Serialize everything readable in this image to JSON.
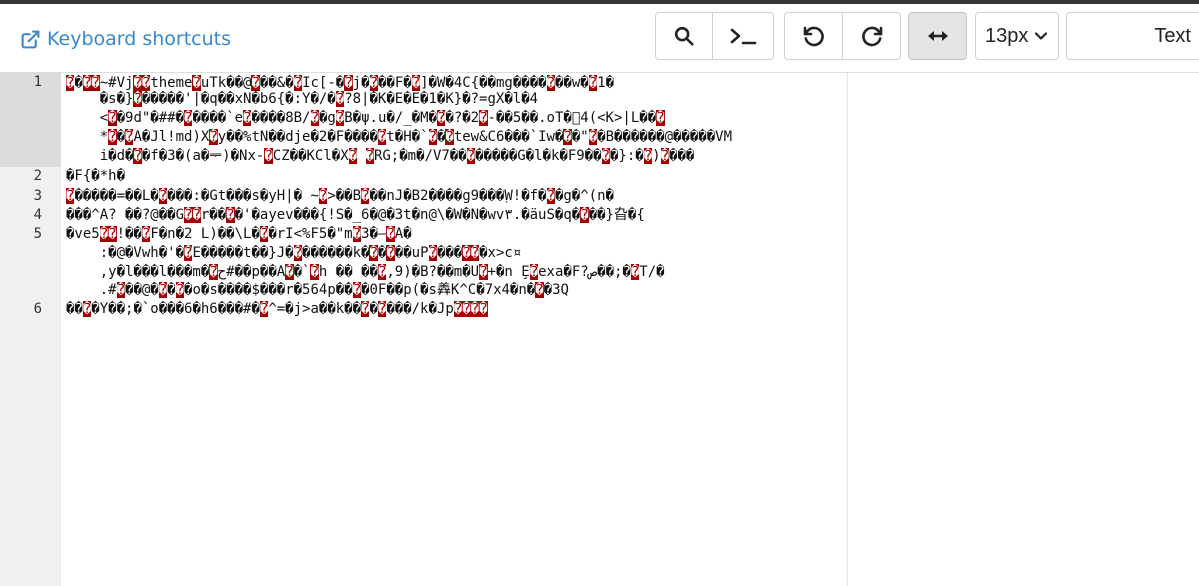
{
  "toolbar": {
    "keyboard_shortcuts_label": "Keyboard shortcuts",
    "font_size_value": "13px",
    "mode_value": "Text"
  },
  "icons": {
    "external_link": "external-link-icon",
    "search": "search-icon",
    "terminal": "terminal-icon",
    "undo": "undo-icon",
    "redo": "redo-icon",
    "wrap": "wrap-arrows-icon",
    "chevron": "chevron-down-icon"
  },
  "colors": {
    "link": "#3a87c8",
    "invalid_char_bg": "#a00000",
    "gutter_bg": "#f0f0f0",
    "gutter_active_bg": "#dcdcdc"
  },
  "editor": {
    "line_numbers": [
      "1",
      "2",
      "3",
      "4",
      "5",
      "6"
    ],
    "lines": [
      [
        [
          {
            "b": "�"
          },
          {
            "t": "�"
          },
          {
            "b": "��"
          },
          {
            "t": "~#Vj"
          },
          {
            "b": "��"
          },
          {
            "t": "theme"
          },
          {
            "b": "�"
          },
          {
            "t": "uTk��@"
          },
          {
            "b": "�"
          },
          {
            "t": "��&�"
          },
          {
            "b": "�"
          },
          {
            "t": "Ic[-�"
          },
          {
            "b": "�"
          },
          {
            "t": "j�"
          },
          {
            "b": "�"
          },
          {
            "t": "��F�"
          },
          {
            "b": "�"
          },
          {
            "t": "]�W�4C{��mg����"
          },
          {
            "b": "�"
          },
          {
            "t": "��w�"
          },
          {
            "b": "�"
          },
          {
            "t": "1�"
          }
        ],
        [
          {
            "t": "    �s�}"
          },
          {
            "b": "�"
          },
          {
            "t": "�����'|�q��xN�b6{�:Y�/�"
          },
          {
            "b": "�"
          },
          {
            "t": "?8|�K�E�E�1�K}�?=gX�l�4"
          }
        ],
        [
          {
            "t": "    <"
          },
          {
            "b": "�"
          },
          {
            "t": "�9d\"�##�"
          },
          {
            "b": "�"
          },
          {
            "t": "����`e"
          },
          {
            "b": "�"
          },
          {
            "t": "����8B/"
          },
          {
            "b": "�"
          },
          {
            "t": "�g"
          },
          {
            "b": "�"
          },
          {
            "t": "B�ψ.u�/_�M�"
          },
          {
            "b": "�"
          },
          {
            "t": "�?�2"
          },
          {
            "b": "�"
          },
          {
            "t": "-��5��.oT�⃞4(<K>|L��"
          },
          {
            "b": "�"
          }
        ],
        [
          {
            "t": "    *"
          },
          {
            "b": "�"
          },
          {
            "t": "�"
          },
          {
            "b": "�"
          },
          {
            "t": "A�Jl!md)X"
          },
          {
            "b": "�"
          },
          {
            "t": "y��%tN��dje�2�F����"
          },
          {
            "b": "�"
          },
          {
            "t": "t�H�`"
          },
          {
            "b": "�"
          },
          {
            "t": "�"
          },
          {
            "b": "�"
          },
          {
            "t": "tew&C6���`Iw�"
          },
          {
            "b": "�"
          },
          {
            "t": "�\""
          },
          {
            "b": "�"
          },
          {
            "t": "�B������@�����VM"
          }
        ],
        [
          {
            "t": "    i�d�"
          },
          {
            "b": "�"
          },
          {
            "t": "�f�3�(a�ᆕ)�Nx-"
          },
          {
            "b": "�"
          },
          {
            "t": "CZ��KCl�X"
          },
          {
            "b": "�"
          },
          {
            "t": " "
          },
          {
            "b": "�"
          },
          {
            "t": "RG;�m�/V7��"
          },
          {
            "b": "�"
          },
          {
            "t": "�����G�l�k�F9��"
          },
          {
            "b": "�"
          },
          {
            "t": "�}:�"
          },
          {
            "b": "�"
          },
          {
            "t": ")"
          },
          {
            "b": "�"
          },
          {
            "t": "���"
          }
        ]
      ],
      [
        [
          {
            "t": "�F{�*h�"
          }
        ]
      ],
      [
        [
          {
            "b": "�"
          },
          {
            "t": "�����=��L�"
          },
          {
            "b": "�"
          },
          {
            "t": "���:�Gt���s�yH|� ~"
          },
          {
            "b": "�"
          },
          {
            "t": ">��B"
          },
          {
            "b": "�"
          },
          {
            "t": "��nJ�B2����g9���ٜW!�f�"
          },
          {
            "b": "�"
          },
          {
            "t": "�g�^(n�"
          }
        ]
      ],
      [
        [
          {
            "t": "���^A? ��?@��G"
          },
          {
            "b": "��"
          },
          {
            "t": "r��"
          },
          {
            "b": "�"
          },
          {
            "t": "�'�ayev���{!S�_6�@�3t�n@\\�W�N�wv٣.�äuS�q�"
          },
          {
            "b": "�"
          },
          {
            "t": "��}旮�{"
          }
        ]
      ],
      [
        [
          {
            "t": "�ve5"
          },
          {
            "b": "��"
          },
          {
            "t": "!��"
          },
          {
            "b": "�"
          },
          {
            "t": "F�n�2 L)��\\L�"
          },
          {
            "b": "�"
          },
          {
            "t": "�rI<%F5�\"m"
          },
          {
            "b": "�"
          },
          {
            "t": "3�—"
          },
          {
            "b": "�"
          },
          {
            "t": "A�"
          }
        ],
        [
          {
            "t": "    :�@�Vwh�'�"
          },
          {
            "b": "�"
          },
          {
            "t": "E�����t��}J�"
          },
          {
            "b": "�"
          },
          {
            "t": "������k�"
          },
          {
            "b": "�"
          },
          {
            "t": "�"
          },
          {
            "b": "�"
          },
          {
            "t": "��uP"
          },
          {
            "b": "�"
          },
          {
            "t": "���"
          },
          {
            "b": "�"
          },
          {
            "t": "ؔ"
          },
          {
            "b": "�"
          },
          {
            "t": "�x>c¤"
          }
        ],
        [
          {
            "t": "    ,y�l���l���m�"
          },
          {
            "b": "�"
          },
          {
            "t": "ح#��p��A"
          },
          {
            "b": "�"
          },
          {
            "t": "�`"
          },
          {
            "b": "�"
          },
          {
            "t": "h �� ��"
          },
          {
            "b": "�"
          },
          {
            "t": ",9)�B?��m�U"
          },
          {
            "b": "�"
          },
          {
            "t": "+�n ̧E"
          },
          {
            "b": "�"
          },
          {
            "t": "exa�F?ص��;�"
          },
          {
            "b": "�"
          },
          {
            "t": "T/�"
          }
        ],
        [
          {
            "t": "    .#"
          },
          {
            "b": "�"
          },
          {
            "t": "��@�"
          },
          {
            "b": "�"
          },
          {
            "t": "�"
          },
          {
            "b": "�"
          },
          {
            "t": "�o�s����$���r�564p��"
          },
          {
            "b": "�"
          },
          {
            "t": "�0F��p(�s羴K^C�7x4�n�"
          },
          {
            "b": "�"
          },
          {
            "t": "�3Q"
          }
        ]
      ],
      [
        [
          {
            "t": "��"
          },
          {
            "b": "�"
          },
          {
            "t": "�Y��;�`o���6�h6���#�"
          },
          {
            "b": "�"
          },
          {
            "t": "^=�j>a��k��"
          },
          {
            "b": "�"
          },
          {
            "t": "�"
          },
          {
            "b": "�"
          },
          {
            "t": "���/k�Jp"
          },
          {
            "b": "����"
          }
        ]
      ]
    ]
  }
}
